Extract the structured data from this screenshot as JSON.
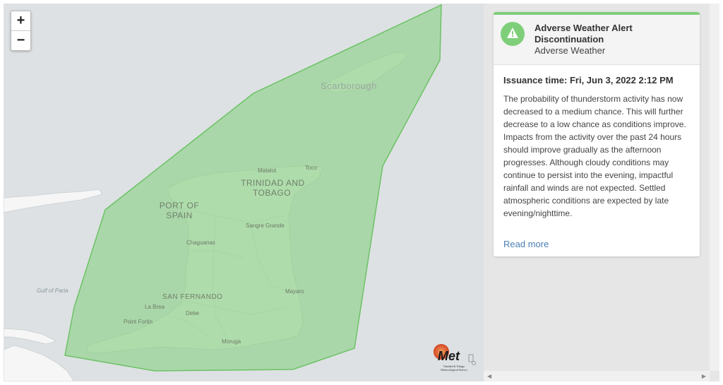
{
  "map": {
    "zoom_in_label": "+",
    "zoom_out_label": "−",
    "labels": {
      "scarborough": "Scarborough",
      "trinidad_tobago_line1": "TRINIDAD AND",
      "trinidad_tobago_line2": "TOBAGO",
      "port_of_spain_line1": "PORT OF",
      "port_of_spain_line2": "SPAIN",
      "matelot": "Matelot",
      "toco": "Toco",
      "sangre_grande": "Sangre Grande",
      "chaguanas": "Chaguanas",
      "gulf_of_paria": "Gulf of Paria",
      "san_fernando": "SAN FERNANDO",
      "la_brea": "La Brea",
      "debe": "Debe",
      "point_fortin": "Point Fortin",
      "mayaro": "Mayaro",
      "moruga": "Moruga"
    },
    "logo_text_line1": "Trinidad & Tobago",
    "logo_text_line2": "Meteorological Service",
    "logo_brand": "Met",
    "alert_area_color": "#7fcf7a"
  },
  "alert": {
    "title": "Adverse Weather Alert Discontinuation",
    "subtitle": "Adverse Weather",
    "icon": "warning-icon",
    "accent_color": "#7fcf7a",
    "issuance_label": "Issuance time:",
    "issuance_value": "Fri, Jun 3, 2022 2:12 PM",
    "description": "The probability of thunderstorm activity has now decreased to a medium chance. This will further decrease to a low chance as conditions improve. Impacts from the activity over the past 24 hours should improve gradually as the afternoon progresses. Although cloudy conditions may continue to persist into the evening, impactful rainfall and winds are not expected. Settled atmospheric conditions are expected by late evening/nighttime.",
    "read_more": "Read more"
  }
}
